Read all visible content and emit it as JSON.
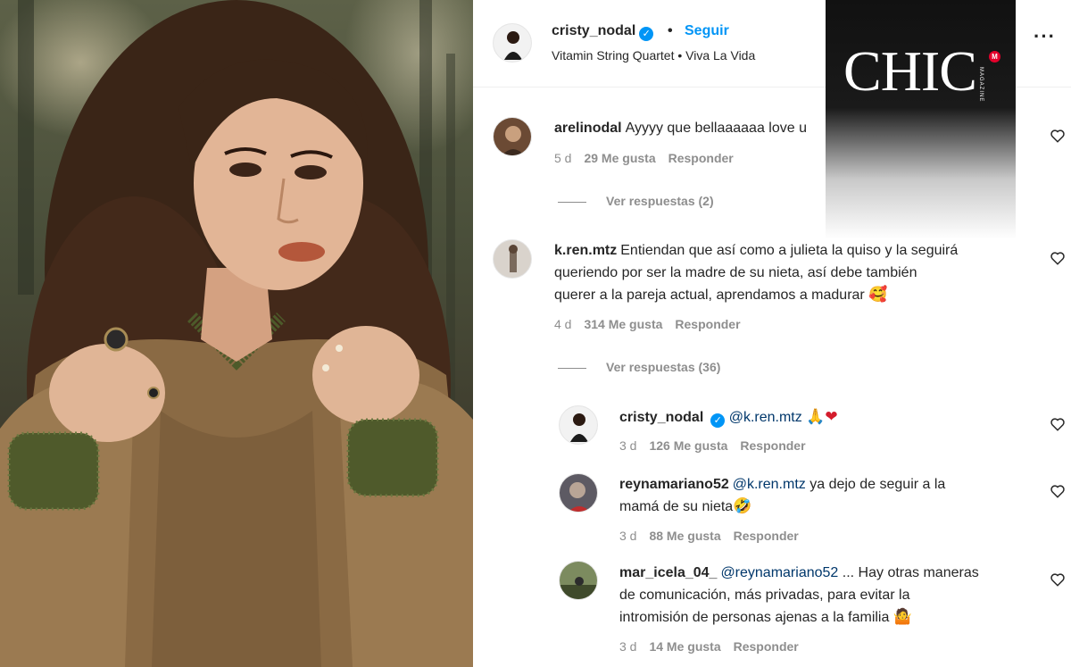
{
  "post": {
    "username": "cristy_nodal",
    "separator": "•",
    "follow_label": "Seguir",
    "song": "Vitamin String Quartet • Viva La Vida",
    "more_icon": "more-horizontal-icon"
  },
  "logo": {
    "text": "CHIC",
    "badge": "M",
    "sub": "MAGAZINE"
  },
  "comments": [
    {
      "username": "arelinodal",
      "text": "Ayyyy que bellaaaaaa love u",
      "time": "5 d",
      "likes": "29 Me gusta",
      "reply": "Responder",
      "view_replies": "Ver respuestas (2)"
    },
    {
      "username": "k.ren.mtz",
      "line1": "Entiendan que así como a julieta la quiso y la seguirá",
      "line2": "queriendo por ser la madre de su nieta, así debe también",
      "line3": "querer a la pareja actual, aprendamos a madurar",
      "emoji": "🥰",
      "time": "4 d",
      "likes": "314 Me gusta",
      "reply": "Responder",
      "view_replies": "Ver respuestas (36)"
    }
  ],
  "replies": [
    {
      "username": "cristy_nodal",
      "mention": "@k.ren.mtz",
      "emoji": "🙏❤",
      "time": "3 d",
      "likes": "126 Me gusta",
      "reply": "Responder"
    },
    {
      "username": "reynamariano52",
      "mention": "@k.ren.mtz",
      "line1": "ya dejo de seguir a la",
      "line2": "mamá de su nieta",
      "emoji": "🤣",
      "time": "3 d",
      "likes": "88 Me gusta",
      "reply": "Responder"
    },
    {
      "username": "mar_icela_04_",
      "mention": "@reynamariano52",
      "line1": "... Hay otras maneras",
      "line2": "de comunicación, más privadas, para evitar la",
      "line3": "intromisión de personas ajenas a la familia",
      "emoji": "🤷",
      "time": "3 d",
      "likes": "14 Me gusta",
      "reply": "Responder"
    }
  ],
  "colors": {
    "link_blue": "#0095f6",
    "mention_blue": "#00376b",
    "meta_gray": "#8e8e8e",
    "logo_red": "#e4002b"
  }
}
